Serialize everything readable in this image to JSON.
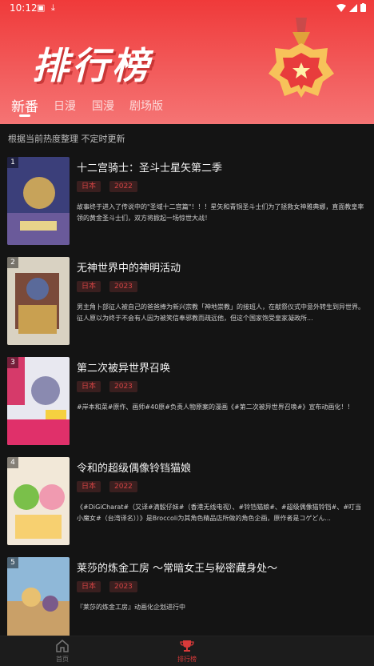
{
  "status": {
    "time": "10:12"
  },
  "banner": {
    "title": "排行榜"
  },
  "tabs": [
    {
      "label": "新番",
      "active": true
    },
    {
      "label": "日漫",
      "active": false
    },
    {
      "label": "国漫",
      "active": false
    },
    {
      "label": "剧场版",
      "active": false
    }
  ],
  "subtitle": "根据当前热度整理  不定时更新",
  "items": [
    {
      "rank": "1",
      "title": "十二宫骑士：圣斗士星矢第二季",
      "region": "日本",
      "year": "2022",
      "desc": "故事终于进入了传说中的\"圣域十二宫篇\"！！！星矢和青铜圣斗士们为了拯救女神雅典娜，直面教皇率领的黄金圣斗士们，双方将掀起一场惊世大战！"
    },
    {
      "rank": "2",
      "title": "无神世界中的神明活动",
      "region": "日本",
      "year": "2023",
      "desc": "男主角卜部征人被自己的爸爸捧为新兴宗教「神地崇教」的接班人，在献祭仪式中意外转生到异世界。征人原以为终于不会有人因为被笑信奉邪教而疏远他，但这个国家饱受皇家凝政所..."
    },
    {
      "rank": "3",
      "title": "第二次被异世界召唤",
      "region": "日本",
      "year": "2023",
      "desc": "#岸本和菜#原作、画师#40原#负责人物原案的漫画《#第二次被异世界召唤#》宣布动画化！！"
    },
    {
      "rank": "4",
      "title": "令和的超级偶像铃铛猫娘",
      "region": "日本",
      "year": "2022",
      "desc": "《#DiGiCharat#（又译#滴骰仔妹#（香港无线电视）、#铃铛猫娘#、#超级偶像猫铃铛#、#叮当小魔女#（台湾译名））》是Broccoli为其角色精品店所做的角色企画，原作者是コゲどん..."
    },
    {
      "rank": "5",
      "title": "莱莎的炼金工房 ～常暗女王与秘密藏身处～",
      "region": "日本",
      "year": "2023",
      "desc": "『莱莎的炼金工房』动画化企划进行中"
    }
  ],
  "nav": [
    {
      "label": "首页",
      "icon": "home-icon",
      "active": false
    },
    {
      "label": "排行榜",
      "icon": "trophy-icon",
      "active": true
    }
  ],
  "colors": {
    "accent": "#d83a3a",
    "header": "#f04848"
  }
}
